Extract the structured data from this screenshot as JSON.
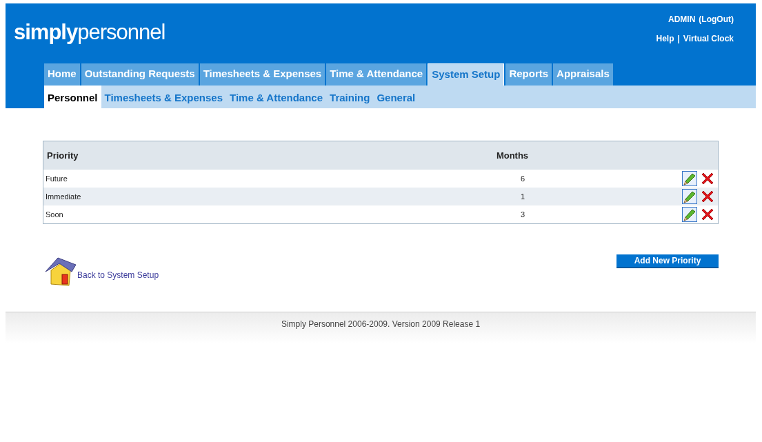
{
  "logo": "**simply**personnel",
  "user_links": {
    "user": "ADMIN",
    "logout": "(LogOut)",
    "help": "Help",
    "separator": "|",
    "clock": "Virtual Clock"
  },
  "tabs": [
    {
      "label": "Home",
      "selected": false
    },
    {
      "label": "Outstanding Requests",
      "selected": false
    },
    {
      "label": "Timesheets & Expenses",
      "selected": false
    },
    {
      "label": "Time & Attendance",
      "selected": false
    },
    {
      "label": "System Setup",
      "selected": true
    },
    {
      "label": "Reports",
      "selected": false
    },
    {
      "label": "Appraisals",
      "selected": false
    }
  ],
  "subtabs": [
    {
      "label": "Personnel",
      "selected": true
    },
    {
      "label": "Timesheets & Expenses",
      "selected": false
    },
    {
      "label": "Time & Attendance",
      "selected": false
    },
    {
      "label": "Training",
      "selected": false
    },
    {
      "label": "General",
      "selected": false
    }
  ],
  "table": {
    "columns": [
      "Priority",
      "Months"
    ],
    "rows": [
      {
        "priority": "Future",
        "months": "6"
      },
      {
        "priority": "Immediate",
        "months": "1"
      },
      {
        "priority": "Soon",
        "months": "3"
      }
    ]
  },
  "back_link": "Back to System Setup",
  "add_button": "Add New Priority",
  "footer": "Simply Personnel 2006-2009. Version 2009 Release 1"
}
